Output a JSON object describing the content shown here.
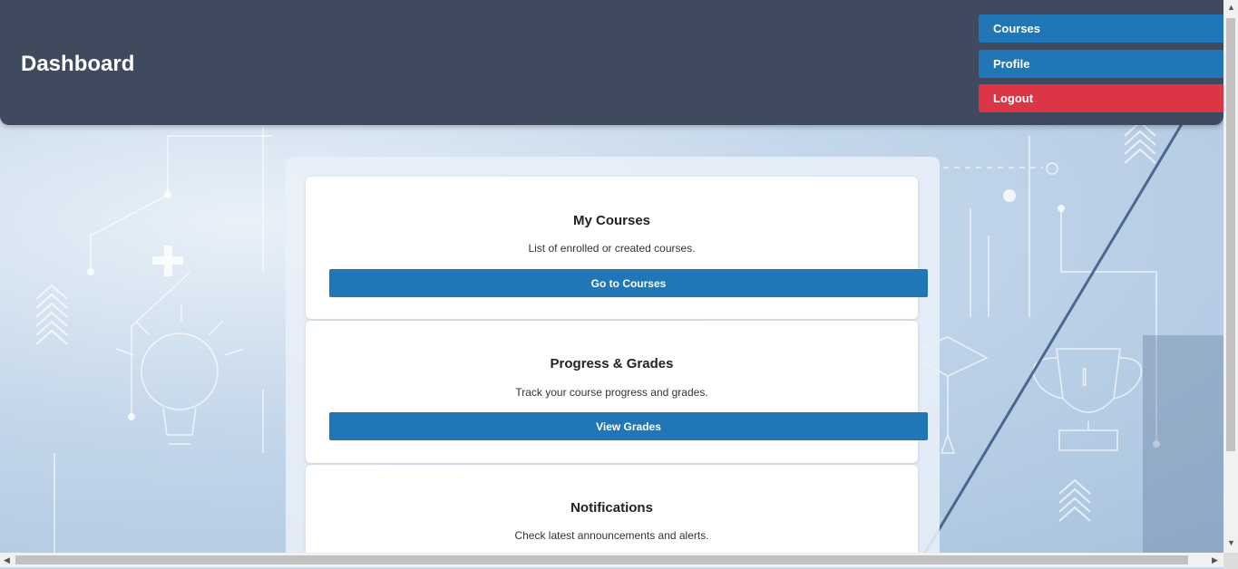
{
  "header": {
    "title": "Dashboard",
    "nav": {
      "courses": "Courses",
      "profile": "Profile",
      "logout": "Logout"
    }
  },
  "cards": [
    {
      "title": "My Courses",
      "description": "List of enrolled or created courses.",
      "button": "Go to Courses"
    },
    {
      "title": "Progress & Grades",
      "description": "Track your course progress and grades.",
      "button": "View Grades"
    },
    {
      "title": "Notifications",
      "description": "Check latest announcements and alerts."
    }
  ],
  "colors": {
    "header_bg": "#3f4a5e",
    "primary": "#2176b5",
    "danger": "#dc3545"
  },
  "icons": [
    "lightbulb-icon",
    "trophy-icon",
    "graduation-cap-icon",
    "plus-icon"
  ]
}
